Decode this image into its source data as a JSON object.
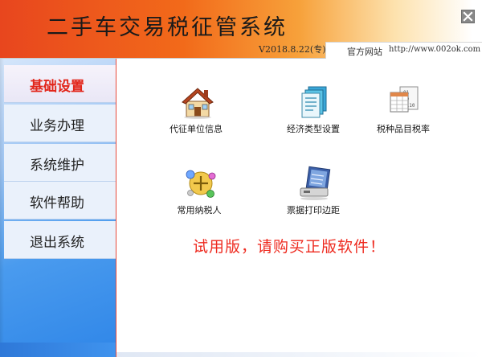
{
  "header": {
    "title": "二手车交易税征管系统",
    "version": "V2018.8.22(专)",
    "website_label": "官方网站",
    "website_url": "http://www.002ok.com"
  },
  "sidebar": {
    "items": [
      {
        "label": "基础设置",
        "active": true
      },
      {
        "label": "业务办理",
        "active": false
      },
      {
        "label": "系统维护",
        "active": false
      },
      {
        "label": "软件帮助",
        "active": false
      },
      {
        "label": "退出系统",
        "active": false
      }
    ]
  },
  "main": {
    "functions": [
      {
        "label": "代征单位信息",
        "icon": "house-icon"
      },
      {
        "label": "经济类型设置",
        "icon": "document-stack-icon"
      },
      {
        "label": "税种品目税率",
        "icon": "spreadsheet-icon"
      },
      {
        "label": "常用纳税人",
        "icon": "taxpayer-icon"
      },
      {
        "label": "票据打印边距",
        "icon": "print-margin-icon"
      }
    ],
    "trial_notice": "试用版，请购买正版软件！"
  },
  "colors": {
    "header_start": "#e8461e",
    "header_end": "#ffffff",
    "active_nav_text": "#e2261b",
    "notice_text": "#ee2a1f",
    "sidebar_blue": "#2f86e8"
  }
}
